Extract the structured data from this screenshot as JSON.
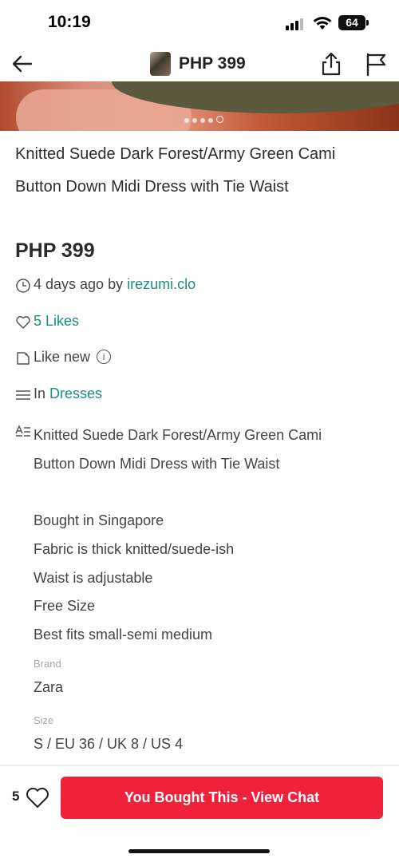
{
  "status_bar": {
    "time": "10:19",
    "battery": "64"
  },
  "header": {
    "price": "PHP 399"
  },
  "listing": {
    "title": "Knitted Suede Dark Forest/Army Green Cami Button Down Midi Dress with Tie Waist",
    "price": "PHP 399",
    "posted": "4 days ago by ",
    "seller": "irezumi.clo",
    "likes": "5 Likes",
    "condition": "Like new",
    "category_prefix": "In ",
    "category": "Dresses",
    "description": [
      "Knitted Suede Dark Forest/Army Green Cami",
      "Button Down Midi Dress with Tie Waist",
      "",
      "Bought in Singapore",
      "Fabric is thick knitted/suede-ish",
      "Waist is adjustable",
      "Free Size",
      "Best fits small-semi medium"
    ],
    "brand_label": "Brand",
    "brand": "Zara",
    "size_label": "Size",
    "size": "S / EU 36 / UK 8 / US 4"
  },
  "carousel": {
    "total": 5,
    "active_index": 4
  },
  "footer": {
    "like_count": "5",
    "cta_label": "You Bought This - View Chat"
  },
  "colors": {
    "accent_teal": "#1a8f7f",
    "cta_red": "#f0213b"
  },
  "icons": [
    "back-arrow-icon",
    "share-icon",
    "flag-icon",
    "clock-icon",
    "heart-icon",
    "tag-icon",
    "info-icon",
    "list-icon",
    "text-icon"
  ]
}
